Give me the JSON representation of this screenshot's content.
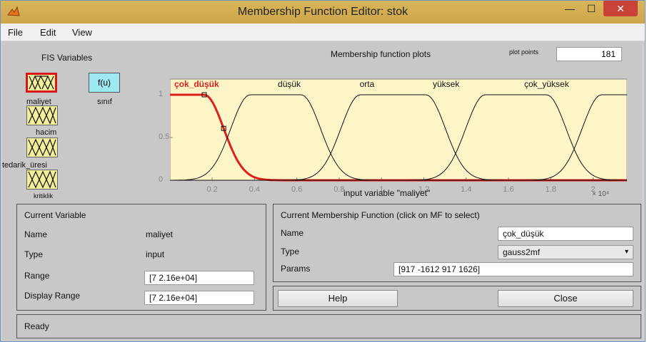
{
  "window": {
    "title": "Membership Function Editor: stok",
    "minimize": "—",
    "maximize": "☐",
    "close": "✕"
  },
  "menu": [
    "File",
    "Edit",
    "View"
  ],
  "fis": {
    "heading": "FIS Variables",
    "inputs": [
      "maliyet",
      "hacim",
      "tedarik_üresi",
      "kritiklik"
    ],
    "output_fn": "f(u)",
    "output_label": "sınıf"
  },
  "plot": {
    "heading": "Membership function plots",
    "plot_points_label": "plot points",
    "plot_points_value": "181",
    "xlabel": "input variable \"maliyet\"",
    "x_exponent": "× 10⁴"
  },
  "chart_data": {
    "type": "line",
    "xlim": [
      7,
      21600
    ],
    "ylim": [
      0,
      1
    ],
    "xticks": [
      0.2,
      0.4,
      0.6,
      0.8,
      1,
      1.2,
      1.4,
      1.6,
      1.8,
      2
    ],
    "yticks": [
      0,
      0.5,
      1
    ],
    "tick_scale": "× 10^4",
    "series": [
      {
        "name": "çok_düşük",
        "mf": "gauss2mf",
        "params": [
          917,
          -1612,
          917,
          1626
        ],
        "selected": true,
        "color": "#e0201a"
      },
      {
        "name": "düşük",
        "mf": "gauss2mf",
        "params": [
          917,
          3800,
          917,
          6200
        ],
        "color": "#111111"
      },
      {
        "name": "orta",
        "mf": "gauss2mf",
        "params": [
          917,
          9000,
          917,
          12100
        ],
        "color": "#111111"
      },
      {
        "name": "yüksek",
        "mf": "gauss2mf",
        "params": [
          917,
          14900,
          917,
          17800
        ],
        "color": "#111111"
      },
      {
        "name": "çok_yüksek",
        "mf": "gauss2mf",
        "params": [
          917,
          20400,
          917,
          25000
        ],
        "color": "#111111"
      }
    ],
    "label_positions": [
      0.137,
      0.236,
      0.415,
      0.575,
      0.775
    ]
  },
  "current_variable": {
    "heading": "Current Variable",
    "name_label": "Name",
    "name_value": "maliyet",
    "type_label": "Type",
    "type_value": "input",
    "range_label": "Range",
    "range_value": "[7 2.16e+04]",
    "display_range_label": "Display Range",
    "display_range_value": "[7 2.16e+04]"
  },
  "current_mf": {
    "heading": "Current Membership Function (click on MF to select)",
    "name_label": "Name",
    "name_value": "çok_düşük",
    "type_label": "Type",
    "type_value": "gauss2mf",
    "params_label": "Params",
    "params_value": "[917 -1612 917 1626]"
  },
  "buttons": {
    "help": "Help",
    "close": "Close"
  },
  "status": "Ready",
  "colors": {
    "selected": "#e0201a",
    "input_box": "#f2ee9a",
    "output_box": "#9ee8f2",
    "plot_bg": "#fbf5c8"
  }
}
